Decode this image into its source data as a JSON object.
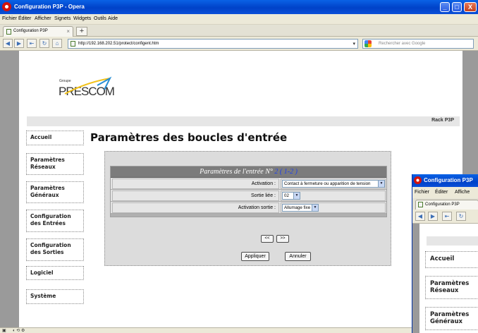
{
  "window": {
    "title": "Configuration P3P - Opera",
    "minimize": "_",
    "maximize": "□",
    "close": "X"
  },
  "menu": {
    "items": [
      "Fichier",
      "Éditer",
      "Afficher",
      "Signets",
      "Widgets",
      "Outils",
      "Aide"
    ]
  },
  "tabs": {
    "active_label": "Configuration P3P",
    "close_glyph": "×",
    "new_tab_glyph": "+"
  },
  "address": {
    "url": "http://192.168.202.51/protect/configent.htm",
    "search_placeholder": "Rechercher avec Google"
  },
  "page": {
    "logo_top": "Groupe",
    "logo_name": "PRESCOM",
    "rack_label": "Rack P3P",
    "heading": "Paramètres des boucles d'entrée",
    "nav": [
      "Accueil",
      "Paramètres Réseaux",
      "Paramètres Généraux",
      "Configuration des Entrées",
      "Configuration des Sorties",
      "Logiciel",
      "Système"
    ],
    "form": {
      "header_prefix": "Paramètres de l'entrée N°",
      "header_number": "2 ( 1-2 )",
      "rows": [
        {
          "label": "Activation :",
          "value": "Contact à fermeture ou apparition de tension"
        },
        {
          "label": "Sortie liée :",
          "value": "02"
        },
        {
          "label": "Activation sortie :",
          "value": "Allumage fixe"
        }
      ],
      "prev_button": "<<",
      "next_button": ">>",
      "apply_button": "Appliquer",
      "cancel_button": "Annuler"
    }
  },
  "second_window": {
    "title": "Configuration P3P",
    "menu": [
      "Fichier",
      "Éditer",
      "Affiche"
    ],
    "tab_label": "Configuration P3P",
    "nav": [
      "Accueil",
      "Paramètres Réseaux",
      "Paramètres Généraux"
    ]
  }
}
